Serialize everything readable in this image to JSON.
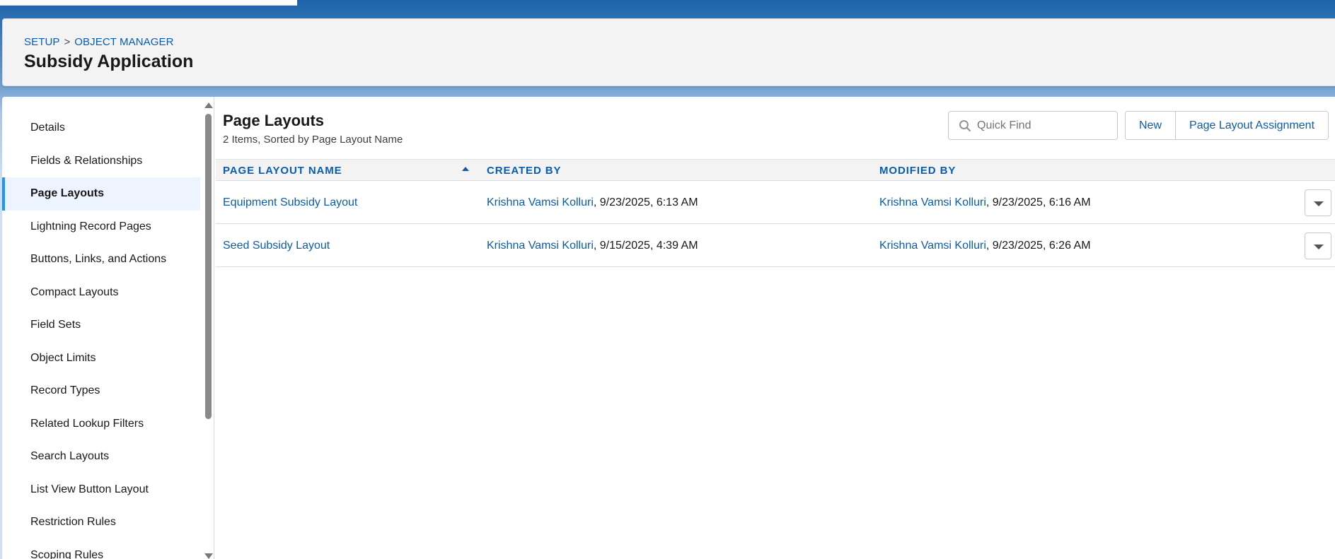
{
  "header": {
    "breadcrumb": [
      {
        "label": "SETUP"
      },
      {
        "label": "OBJECT MANAGER"
      }
    ],
    "breadcrumb_separator": ">",
    "title": "Subsidy Application"
  },
  "sidebar": {
    "items": [
      {
        "label": "Details"
      },
      {
        "label": "Fields & Relationships"
      },
      {
        "label": "Page Layouts",
        "active": true
      },
      {
        "label": "Lightning Record Pages"
      },
      {
        "label": "Buttons, Links, and Actions"
      },
      {
        "label": "Compact Layouts"
      },
      {
        "label": "Field Sets"
      },
      {
        "label": "Object Limits"
      },
      {
        "label": "Record Types"
      },
      {
        "label": "Related Lookup Filters"
      },
      {
        "label": "Search Layouts"
      },
      {
        "label": "List View Button Layout"
      },
      {
        "label": "Restriction Rules"
      },
      {
        "label": "Scoping Rules"
      }
    ]
  },
  "main": {
    "title": "Page Layouts",
    "subtitle": "2 Items, Sorted by Page Layout Name",
    "search": {
      "placeholder": "Quick Find",
      "value": ""
    },
    "buttons": {
      "new_label": "New",
      "assignment_label": "Page Layout Assignment"
    },
    "table": {
      "columns": [
        "PAGE LAYOUT NAME",
        "CREATED BY",
        "MODIFIED BY"
      ],
      "sort": {
        "column": "PAGE LAYOUT NAME",
        "direction": "ascending"
      },
      "rows": [
        {
          "name": "Equipment Subsidy Layout",
          "created_user": "Krishna Vamsi Kolluri",
          "created_date": ", 9/23/2025, 6:13 AM",
          "modified_user": "Krishna Vamsi Kolluri",
          "modified_date": ", 9/23/2025, 6:16 AM"
        },
        {
          "name": "Seed Subsidy Layout",
          "created_user": "Krishna Vamsi Kolluri",
          "created_date": ", 9/15/2025, 4:39 AM",
          "modified_user": "Krishna Vamsi Kolluri",
          "modified_date": ", 9/23/2025, 6:26 AM"
        }
      ]
    }
  },
  "colors": {
    "link": "#0b5cab",
    "active_nav_bg": "#eef4ff",
    "active_nav_border": "#1b96ff",
    "brand_band": "#1e63a8"
  }
}
